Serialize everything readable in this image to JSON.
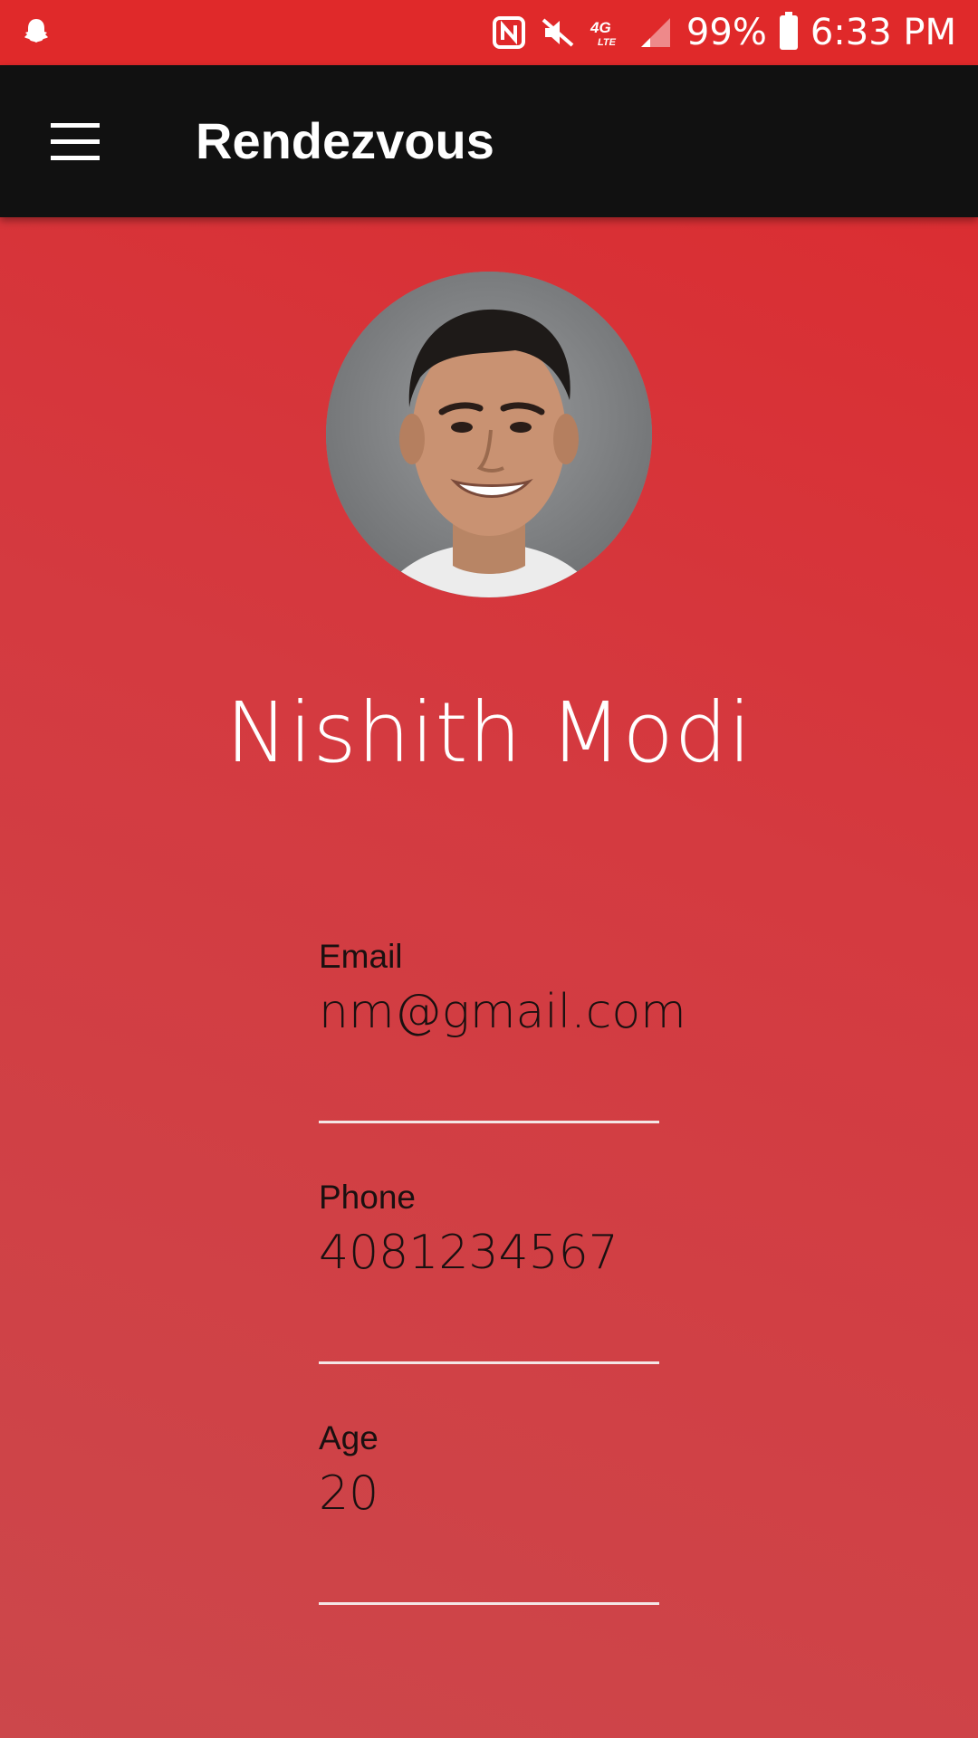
{
  "status_bar": {
    "battery": "99%",
    "time": "6:33 PM",
    "network": "4G LTE",
    "icons": [
      "snapchat-ghost-icon",
      "nfc-icon",
      "mute-icon",
      "network-4g-lte-icon",
      "signal-icon",
      "battery-icon"
    ]
  },
  "app_bar": {
    "title": "Rendezvous",
    "menu_icon": "hamburger-menu-icon",
    "background": "#111111"
  },
  "profile": {
    "name": "Nishith Modi",
    "avatar": "profile-photo",
    "fields": [
      {
        "label": "Email",
        "value": "nm@gmail.com"
      },
      {
        "label": "Phone",
        "value": "4081234567"
      },
      {
        "label": "Age",
        "value": "20"
      }
    ]
  },
  "colors": {
    "accent": "#e0292a",
    "background_gradient": [
      "#dc2a2e",
      "#cc474b"
    ],
    "text_dark": "#1a1010",
    "text_light": "#ffffff"
  }
}
